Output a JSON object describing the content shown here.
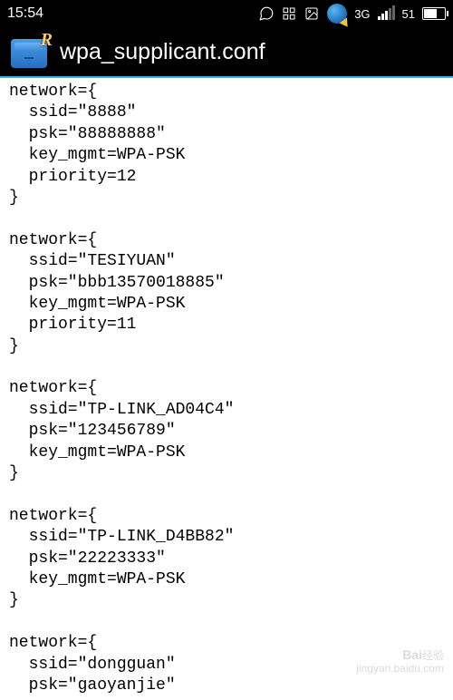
{
  "status": {
    "time": "15:54",
    "network_type": "3G",
    "signal_value": "51",
    "icons": [
      "chat-bubble",
      "grid",
      "image",
      "globe"
    ]
  },
  "header": {
    "title": "wpa_supplicant.conf",
    "icon_letter": "R"
  },
  "networks": [
    {
      "ssid": "8888",
      "psk": "88888888",
      "key_mgmt": "WPA-PSK",
      "priority": "12"
    },
    {
      "ssid": "TESIYUAN",
      "psk": "bbb13570018885",
      "key_mgmt": "WPA-PSK",
      "priority": "11"
    },
    {
      "ssid": "TP-LINK_AD04C4",
      "psk": "123456789",
      "key_mgmt": "WPA-PSK"
    },
    {
      "ssid": "TP-LINK_D4BB82",
      "psk": "22223333",
      "key_mgmt": "WPA-PSK"
    },
    {
      "ssid": "dongguan",
      "psk": "gaoyanjie"
    }
  ],
  "watermark": {
    "brand": "Bai",
    "brand2": "经验",
    "url": "jingyan.baidu.com"
  },
  "labels": {
    "network": "network={",
    "ssid": "ssid=",
    "psk": "psk=",
    "key_mgmt": "key_mgmt=",
    "priority": "priority=",
    "close": "}"
  }
}
